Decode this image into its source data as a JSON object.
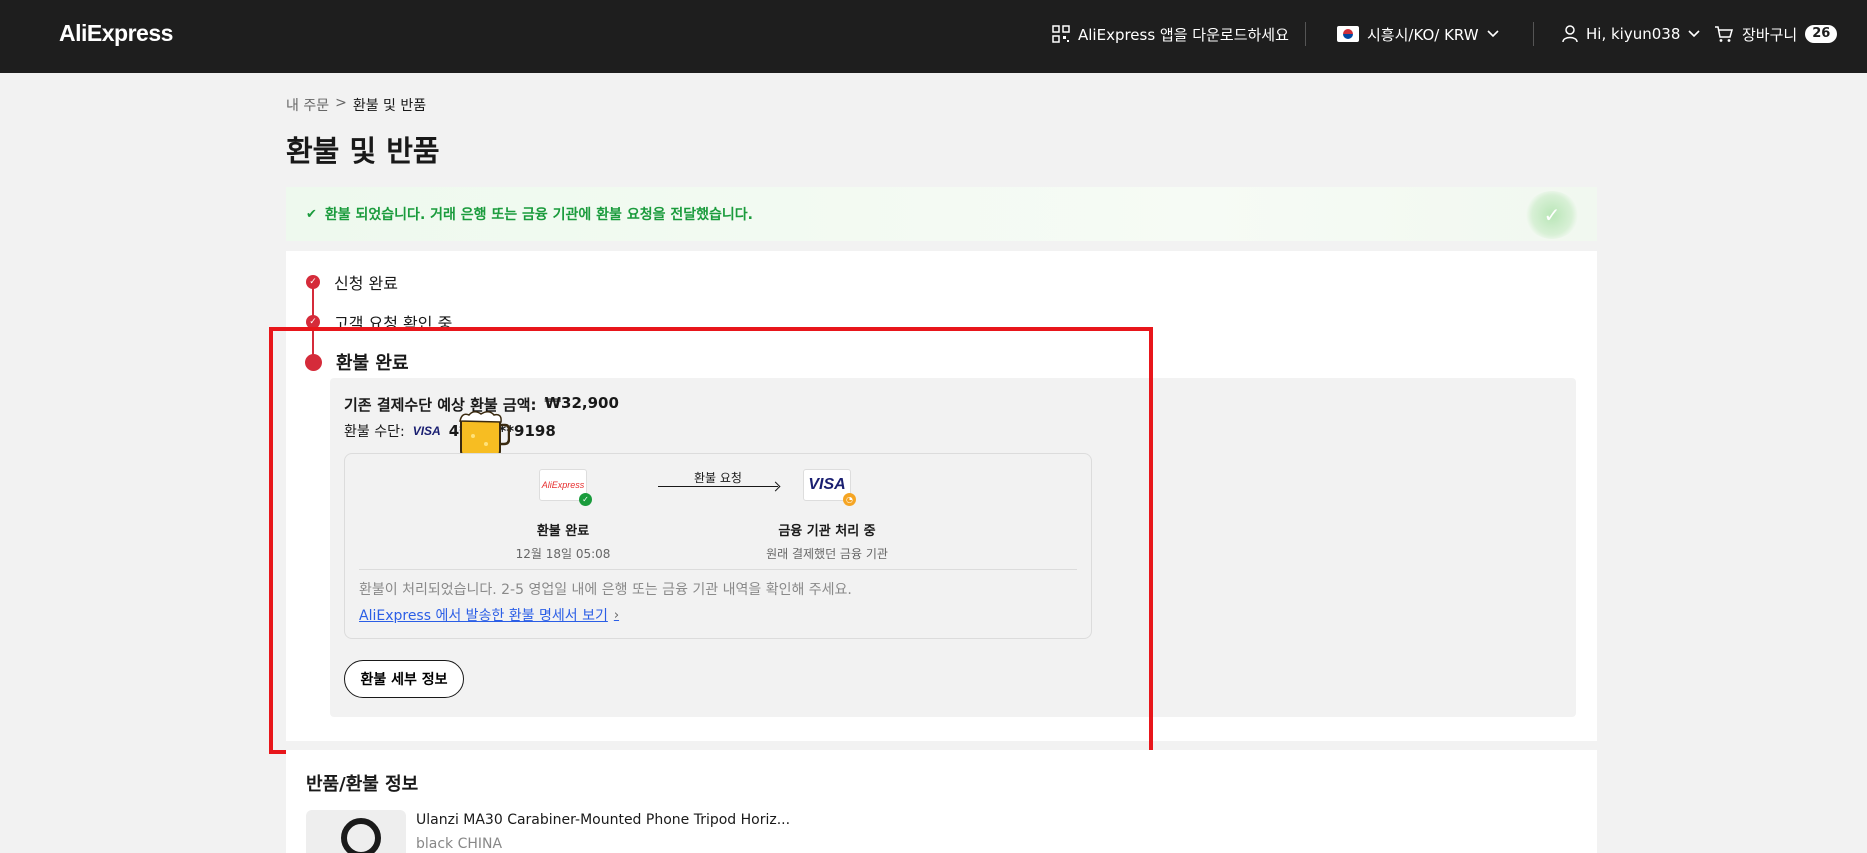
{
  "header": {
    "logo": "AliExpress",
    "app_download": "AliExpress 앱을 다운로드하세요",
    "region": "시흥시/KO/ KRW",
    "greeting": "Hi, kiyun038",
    "cart_label": "장바구니",
    "cart_count": "26"
  },
  "breadcrumb": {
    "parent": "내 주문",
    "separator": ">",
    "current": "환불 및 반품"
  },
  "page_title": "환불 및 반품",
  "banner": {
    "message": "환불 되었습니다. 거래 은행 또는 금융 기관에 환불 요청을 전달했습니다."
  },
  "steps": [
    {
      "label": "신청 완료"
    },
    {
      "label": "고객 요청 확인 중"
    },
    {
      "label": "환불 완료"
    }
  ],
  "refund": {
    "amount_label": "기존 결제수단 예상 환불 금액:",
    "amount_value": "₩32,900",
    "method_label": "환불 수단:",
    "card_brand": "VISA",
    "card_number": "4*******9198"
  },
  "flow": {
    "from_logo": "AliExpress",
    "from_title": "환불 완료",
    "from_date": "12월 18일 05:08",
    "arrow_label": "환불 요청",
    "to_logo": "VISA",
    "to_title": "금융 기관 처리 중",
    "to_sub": "원래 결제했던 금융 기관",
    "note": "환불이 처리되었습니다. 2-5 영업일 내에 은행 또는 금융 기관 내역을 확인해 주세요.",
    "link_text": "AliExpress 에서 발송한 환불 명세서 보기",
    "link_chevron": "›"
  },
  "detail_button": "환불 세부 정보",
  "return_info": {
    "title": "반품/환불 정보",
    "product_name": "Ulanzi MA30 Carabiner-Mounted Phone Tripod Horiz...",
    "product_variant": "black CHINA"
  },
  "colors": {
    "accent_red": "#d52b3a",
    "success_green": "#1a9b3c",
    "link_blue": "#2b5ee6",
    "highlight_red": "#e8161b"
  }
}
